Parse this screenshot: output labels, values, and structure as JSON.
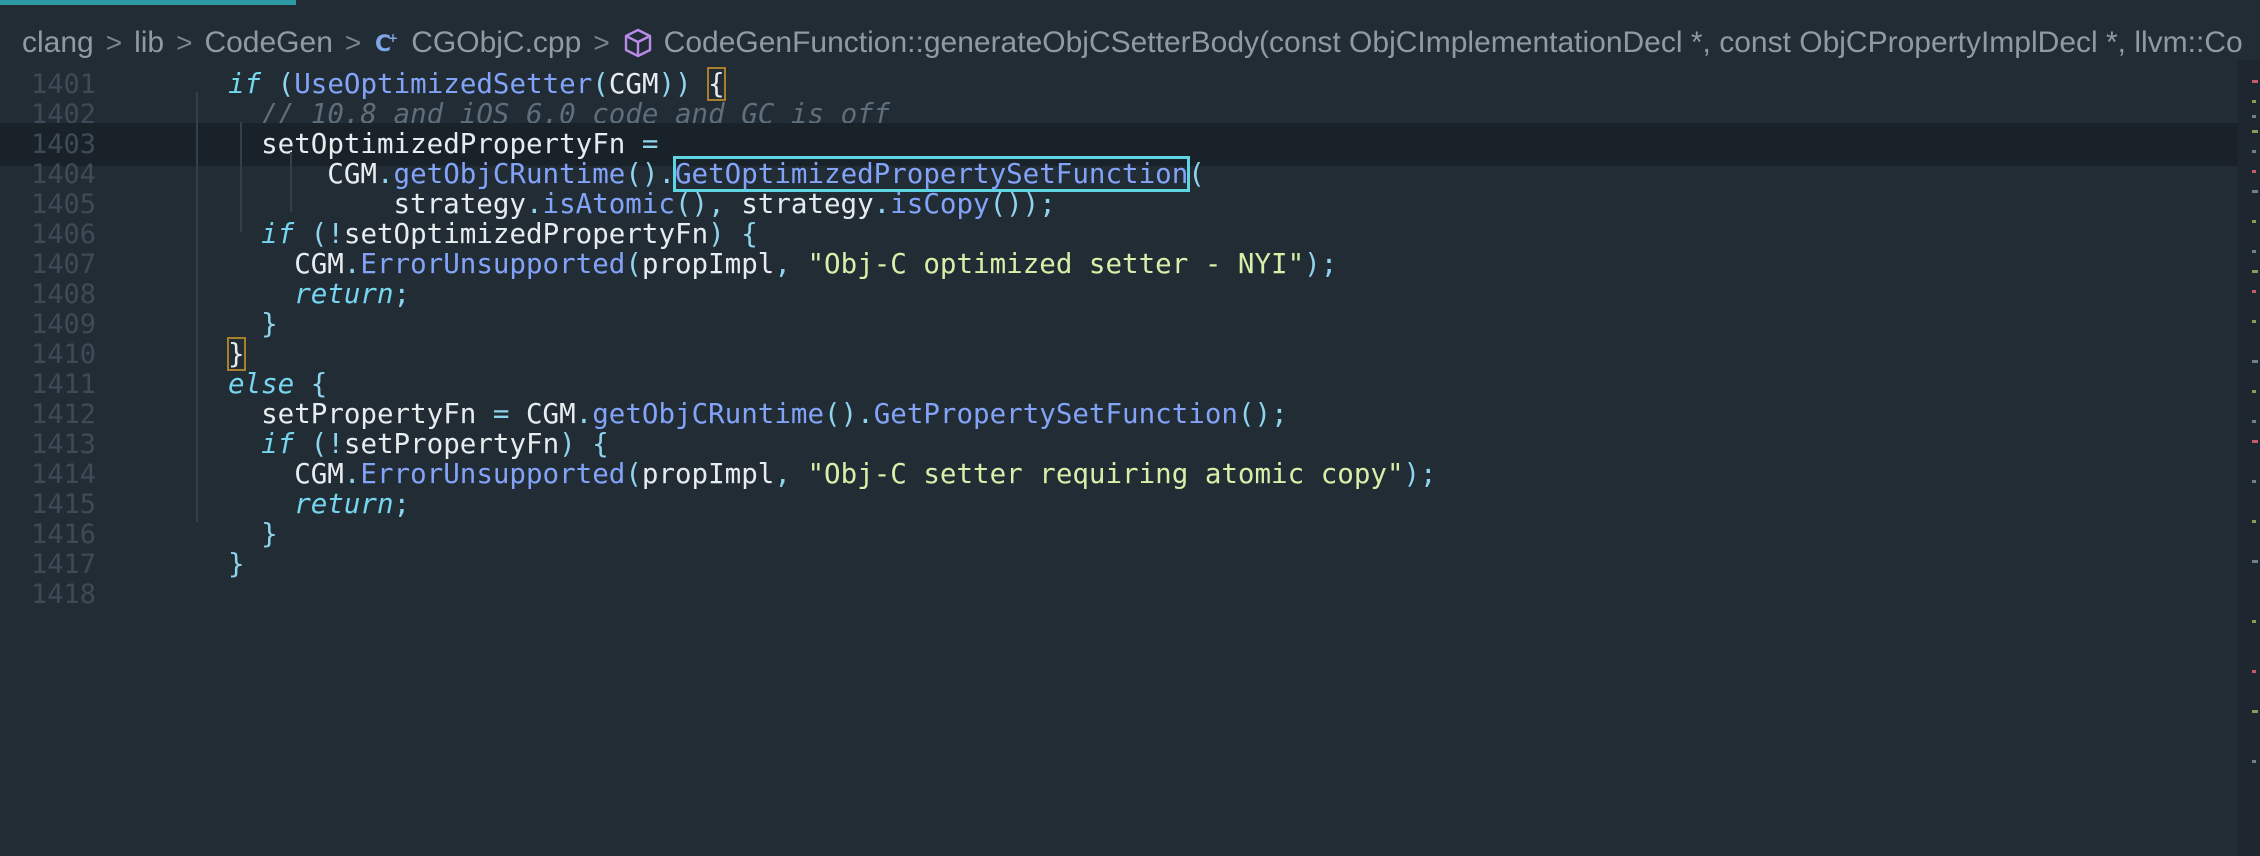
{
  "breadcrumb": {
    "items": [
      {
        "label": "clang"
      },
      {
        "label": "lib"
      },
      {
        "label": "CodeGen"
      },
      {
        "label": "CGObjC.cpp",
        "icon": "cpp-file-icon"
      },
      {
        "label": "CodeGenFunction::generateObjCSetterBody(const ObjCImplementationDecl *, const ObjCPropertyImplDecl *, llvm::Co",
        "icon": "method-cube-icon"
      }
    ],
    "separator": ">"
  },
  "colors": {
    "background": "#222c35",
    "keyword": "#76d6ef",
    "function": "#82a3f7",
    "string": "#d5f0a9",
    "comment": "#5e6e7a",
    "highlight_border": "#5ed5e3",
    "bracket_match": "#a8802c"
  },
  "editor": {
    "active_line": 1403,
    "lines": [
      {
        "num": "1401",
        "indent": 1,
        "tokens": [
          {
            "t": "if",
            "c": "kw"
          },
          {
            "t": " (",
            "c": "op"
          },
          {
            "t": "UseOptimizedSetter",
            "c": "fn"
          },
          {
            "t": "(",
            "c": "op"
          },
          {
            "t": "CGM",
            "c": "id"
          },
          {
            "t": ")) ",
            "c": "op"
          },
          {
            "t": "{",
            "c": "br"
          }
        ]
      },
      {
        "num": "1402",
        "indent": 2,
        "tokens": [
          {
            "t": "// 10.8 and iOS 6.0 code and GC is off",
            "c": "cm"
          }
        ]
      },
      {
        "num": "1403",
        "indent": 2,
        "tokens": [
          {
            "t": "setOptimizedPropertyFn",
            "c": "id"
          },
          {
            "t": " =",
            "c": "op"
          }
        ]
      },
      {
        "num": "1404",
        "indent": 4,
        "tokens": [
          {
            "t": "CGM",
            "c": "id"
          },
          {
            "t": ".",
            "c": "op"
          },
          {
            "t": "getObjCRuntime",
            "c": "fn"
          },
          {
            "t": "().",
            "c": "op"
          },
          {
            "t": "GetOptimizedPropertySetFunction",
            "c": "hl"
          },
          {
            "t": "(",
            "c": "op"
          }
        ]
      },
      {
        "num": "1405",
        "indent": 6,
        "tokens": [
          {
            "t": "strategy",
            "c": "id"
          },
          {
            "t": ".",
            "c": "op"
          },
          {
            "t": "isAtomic",
            "c": "fn"
          },
          {
            "t": "(), ",
            "c": "op"
          },
          {
            "t": "strategy",
            "c": "id"
          },
          {
            "t": ".",
            "c": "op"
          },
          {
            "t": "isCopy",
            "c": "fn"
          },
          {
            "t": "());",
            "c": "op"
          }
        ]
      },
      {
        "num": "1406",
        "indent": 2,
        "tokens": [
          {
            "t": "if",
            "c": "kw"
          },
          {
            "t": " (!",
            "c": "op"
          },
          {
            "t": "setOptimizedPropertyFn",
            "c": "id"
          },
          {
            "t": ") {",
            "c": "op"
          }
        ]
      },
      {
        "num": "1407",
        "indent": 3,
        "tokens": [
          {
            "t": "CGM",
            "c": "id"
          },
          {
            "t": ".",
            "c": "op"
          },
          {
            "t": "ErrorUnsupported",
            "c": "fn"
          },
          {
            "t": "(",
            "c": "op"
          },
          {
            "t": "propImpl",
            "c": "id"
          },
          {
            "t": ", ",
            "c": "op"
          },
          {
            "t": "\"Obj-C optimized setter - NYI\"",
            "c": "str"
          },
          {
            "t": ");",
            "c": "op"
          }
        ]
      },
      {
        "num": "1408",
        "indent": 3,
        "tokens": [
          {
            "t": "return",
            "c": "kw"
          },
          {
            "t": ";",
            "c": "op"
          }
        ]
      },
      {
        "num": "1409",
        "indent": 2,
        "tokens": [
          {
            "t": "}",
            "c": "op"
          }
        ]
      },
      {
        "num": "1410",
        "indent": 1,
        "tokens": [
          {
            "t": "}",
            "c": "br"
          }
        ]
      },
      {
        "num": "1411",
        "indent": 1,
        "tokens": [
          {
            "t": "else",
            "c": "kw"
          },
          {
            "t": " {",
            "c": "op"
          }
        ]
      },
      {
        "num": "1412",
        "indent": 2,
        "tokens": [
          {
            "t": "setPropertyFn",
            "c": "id"
          },
          {
            "t": " = ",
            "c": "op"
          },
          {
            "t": "CGM",
            "c": "id"
          },
          {
            "t": ".",
            "c": "op"
          },
          {
            "t": "getObjCRuntime",
            "c": "fn"
          },
          {
            "t": "().",
            "c": "op"
          },
          {
            "t": "GetPropertySetFunction",
            "c": "fn"
          },
          {
            "t": "();",
            "c": "op"
          }
        ]
      },
      {
        "num": "1413",
        "indent": 2,
        "tokens": [
          {
            "t": "if",
            "c": "kw"
          },
          {
            "t": " (!",
            "c": "op"
          },
          {
            "t": "setPropertyFn",
            "c": "id"
          },
          {
            "t": ") {",
            "c": "op"
          }
        ]
      },
      {
        "num": "1414",
        "indent": 3,
        "tokens": [
          {
            "t": "CGM",
            "c": "id"
          },
          {
            "t": ".",
            "c": "op"
          },
          {
            "t": "ErrorUnsupported",
            "c": "fn"
          },
          {
            "t": "(",
            "c": "op"
          },
          {
            "t": "propImpl",
            "c": "id"
          },
          {
            "t": ", ",
            "c": "op"
          },
          {
            "t": "\"Obj-C setter requiring atomic copy\"",
            "c": "str"
          },
          {
            "t": ");",
            "c": "op"
          }
        ]
      },
      {
        "num": "1415",
        "indent": 3,
        "tokens": [
          {
            "t": "return",
            "c": "kw"
          },
          {
            "t": ";",
            "c": "op"
          }
        ]
      },
      {
        "num": "1416",
        "indent": 2,
        "tokens": [
          {
            "t": "}",
            "c": "op"
          }
        ]
      },
      {
        "num": "1417",
        "indent": 1,
        "tokens": [
          {
            "t": "}",
            "c": "op"
          }
        ]
      },
      {
        "num": "1418",
        "indent": 0,
        "tokens": []
      }
    ]
  }
}
